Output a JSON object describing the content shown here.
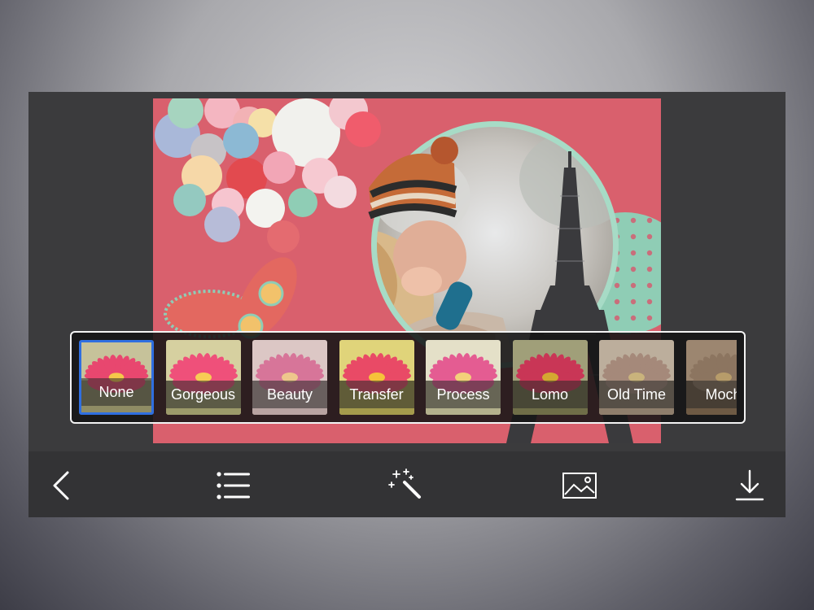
{
  "filters": {
    "items": [
      {
        "label": "None",
        "selected": true
      },
      {
        "label": "Gorgeous",
        "selected": false
      },
      {
        "label": "Beauty",
        "selected": false
      },
      {
        "label": "Transfer",
        "selected": false
      },
      {
        "label": "Process",
        "selected": false
      },
      {
        "label": "Lomo",
        "selected": false
      },
      {
        "label": "Old Time",
        "selected": false
      },
      {
        "label": "Moch",
        "selected": false
      }
    ]
  },
  "toolbar": {
    "tools": [
      {
        "icon": "chevron-left-icon"
      },
      {
        "icon": "list-icon"
      },
      {
        "icon": "magic-wand-icon"
      },
      {
        "icon": "image-icon"
      },
      {
        "icon": "download-icon"
      }
    ]
  },
  "colors": {
    "frame_pink": "#d9606d",
    "mint": "#8fcdb5",
    "selection_blue": "#2f6fe0",
    "toolbar_bg": "#333335"
  }
}
